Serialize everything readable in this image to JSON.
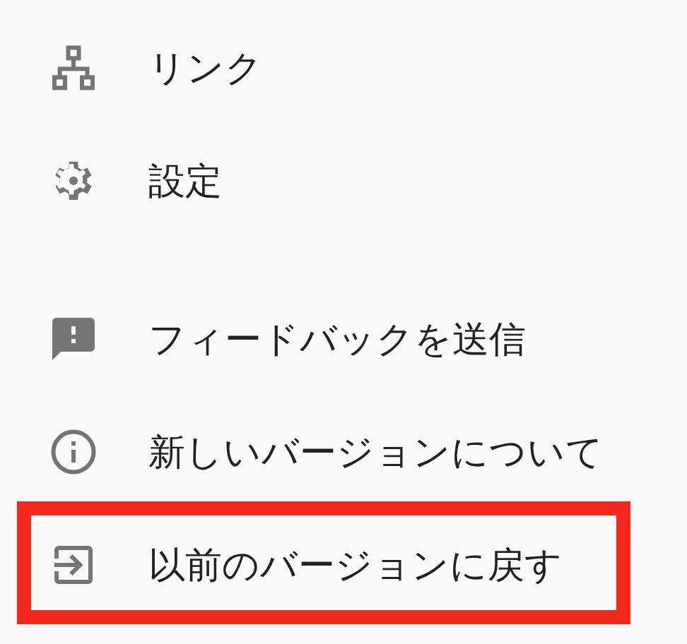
{
  "sections": [
    {
      "items": [
        {
          "label": "リンク",
          "highlighted": false
        },
        {
          "label": "設定",
          "highlighted": false
        }
      ]
    },
    {
      "items": [
        {
          "label": "フィードバックを送信",
          "highlighted": false
        },
        {
          "label": "新しいバージョンについて",
          "highlighted": false
        },
        {
          "label": "以前のバージョンに戻す",
          "highlighted": true
        }
      ]
    }
  ]
}
